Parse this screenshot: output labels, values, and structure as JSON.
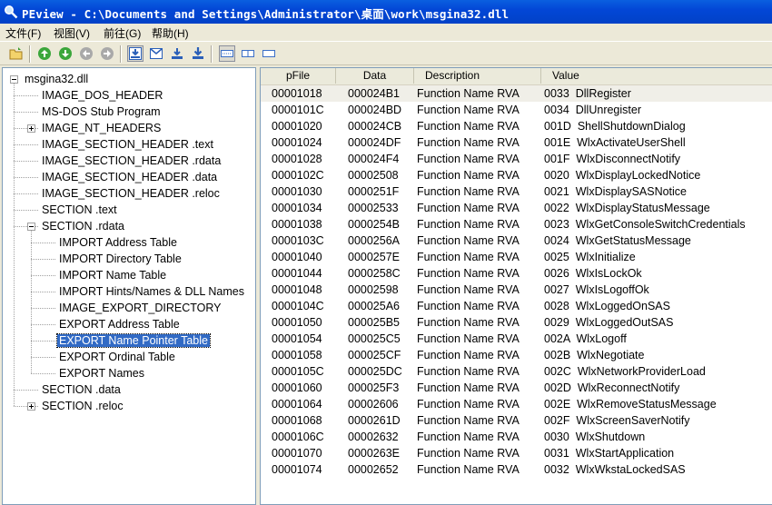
{
  "window": {
    "title": "PEview - C:\\Documents and Settings\\Administrator\\桌面\\work\\msgina32.dll"
  },
  "menu": [
    {
      "label": "文件(F)"
    },
    {
      "label": "视图(V)"
    },
    {
      "label": "前往(G)"
    },
    {
      "label": "帮助(H)"
    }
  ],
  "toolbar": {
    "buttons": [
      {
        "name": "open-folder-icon"
      },
      {
        "name": "back-green-icon"
      },
      {
        "name": "forward-green-icon"
      },
      {
        "name": "back-gray-icon"
      },
      {
        "name": "forward-gray-icon"
      },
      {
        "name": "view-byte-icon"
      },
      {
        "name": "view-word-icon"
      },
      {
        "name": "view-dword-icon"
      },
      {
        "name": "view-qword-icon"
      },
      {
        "name": "view-details-icon"
      },
      {
        "name": "view-hex-icon"
      },
      {
        "name": "view-ascii-icon"
      }
    ]
  },
  "tree": [
    {
      "label": "msgina32.dll",
      "level": 0,
      "expander": "minus"
    },
    {
      "label": "IMAGE_DOS_HEADER",
      "level": 1,
      "expander": ""
    },
    {
      "label": "MS-DOS Stub Program",
      "level": 1,
      "expander": ""
    },
    {
      "label": "IMAGE_NT_HEADERS",
      "level": 1,
      "expander": "plus"
    },
    {
      "label": "IMAGE_SECTION_HEADER .text",
      "level": 1,
      "expander": ""
    },
    {
      "label": "IMAGE_SECTION_HEADER .rdata",
      "level": 1,
      "expander": ""
    },
    {
      "label": "IMAGE_SECTION_HEADER .data",
      "level": 1,
      "expander": ""
    },
    {
      "label": "IMAGE_SECTION_HEADER .reloc",
      "level": 1,
      "expander": ""
    },
    {
      "label": "SECTION .text",
      "level": 1,
      "expander": ""
    },
    {
      "label": "SECTION .rdata",
      "level": 1,
      "expander": "minus"
    },
    {
      "label": "IMPORT Address Table",
      "level": 2,
      "expander": ""
    },
    {
      "label": "IMPORT Directory Table",
      "level": 2,
      "expander": ""
    },
    {
      "label": "IMPORT Name Table",
      "level": 2,
      "expander": ""
    },
    {
      "label": "IMPORT Hints/Names & DLL Names",
      "level": 2,
      "expander": ""
    },
    {
      "label": "IMAGE_EXPORT_DIRECTORY",
      "level": 2,
      "expander": ""
    },
    {
      "label": "EXPORT Address Table",
      "level": 2,
      "expander": ""
    },
    {
      "label": "EXPORT Name Pointer Table",
      "level": 2,
      "expander": "",
      "selected": true
    },
    {
      "label": "EXPORT Ordinal Table",
      "level": 2,
      "expander": ""
    },
    {
      "label": "EXPORT Names",
      "level": 2,
      "expander": ""
    },
    {
      "label": "SECTION .data",
      "level": 1,
      "expander": ""
    },
    {
      "label": "SECTION .reloc",
      "level": 1,
      "expander": "plus"
    }
  ],
  "table": {
    "columns": [
      "pFile",
      "Data",
      "Description",
      "Value"
    ],
    "rows": [
      [
        "00001018",
        "000024B1",
        "Function Name RVA",
        "0033  DllRegister"
      ],
      [
        "0000101C",
        "000024BD",
        "Function Name RVA",
        "0034  DllUnregister"
      ],
      [
        "00001020",
        "000024CB",
        "Function Name RVA",
        "001D  ShellShutdownDialog"
      ],
      [
        "00001024",
        "000024DF",
        "Function Name RVA",
        "001E  WlxActivateUserShell"
      ],
      [
        "00001028",
        "000024F4",
        "Function Name RVA",
        "001F  WlxDisconnectNotify"
      ],
      [
        "0000102C",
        "00002508",
        "Function Name RVA",
        "0020  WlxDisplayLockedNotice"
      ],
      [
        "00001030",
        "0000251F",
        "Function Name RVA",
        "0021  WlxDisplaySASNotice"
      ],
      [
        "00001034",
        "00002533",
        "Function Name RVA",
        "0022  WlxDisplayStatusMessage"
      ],
      [
        "00001038",
        "0000254B",
        "Function Name RVA",
        "0023  WlxGetConsoleSwitchCredentials"
      ],
      [
        "0000103C",
        "0000256A",
        "Function Name RVA",
        "0024  WlxGetStatusMessage"
      ],
      [
        "00001040",
        "0000257E",
        "Function Name RVA",
        "0025  WlxInitialize"
      ],
      [
        "00001044",
        "0000258C",
        "Function Name RVA",
        "0026  WlxIsLockOk"
      ],
      [
        "00001048",
        "00002598",
        "Function Name RVA",
        "0027  WlxIsLogoffOk"
      ],
      [
        "0000104C",
        "000025A6",
        "Function Name RVA",
        "0028  WlxLoggedOnSAS"
      ],
      [
        "00001050",
        "000025B5",
        "Function Name RVA",
        "0029  WlxLoggedOutSAS"
      ],
      [
        "00001054",
        "000025C5",
        "Function Name RVA",
        "002A  WlxLogoff"
      ],
      [
        "00001058",
        "000025CF",
        "Function Name RVA",
        "002B  WlxNegotiate"
      ],
      [
        "0000105C",
        "000025DC",
        "Function Name RVA",
        "002C  WlxNetworkProviderLoad"
      ],
      [
        "00001060",
        "000025F3",
        "Function Name RVA",
        "002D  WlxReconnectNotify"
      ],
      [
        "00001064",
        "00002606",
        "Function Name RVA",
        "002E  WlxRemoveStatusMessage"
      ],
      [
        "00001068",
        "0000261D",
        "Function Name RVA",
        "002F  WlxScreenSaverNotify"
      ],
      [
        "0000106C",
        "00002632",
        "Function Name RVA",
        "0030  WlxShutdown"
      ],
      [
        "00001070",
        "0000263E",
        "Function Name RVA",
        "0031  WlxStartApplication"
      ],
      [
        "00001074",
        "00002652",
        "Function Name RVA",
        "0032  WlxWkstaLockedSAS"
      ]
    ]
  },
  "colors": {
    "titlebar": "#0347d6",
    "selection": "#316ac5",
    "chrome": "#ece9d8"
  }
}
